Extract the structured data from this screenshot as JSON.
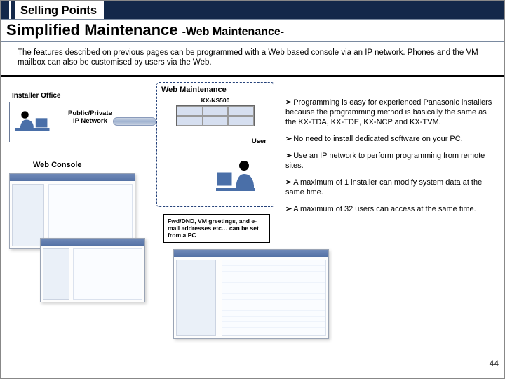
{
  "header": {
    "section": "Selling Points",
    "title_main": "Simplified Maintenance ",
    "title_sub": "-Web Maintenance-"
  },
  "intro": "The features described on previous pages can be programmed with a Web based console via an IP network. Phones and the VM mailbox can also be customised by users via the Web.",
  "diagram": {
    "installer_office": "Installer Office",
    "network": "Public/Private\nIP Network",
    "panel_title": "Web Maintenance",
    "device": "KX-NS500",
    "user": "User",
    "web_console": "Web Console",
    "note": "Fwd/DND, VM greetings, and e-mail addresses etc… can be set from a PC"
  },
  "bullets": [
    "Programming is easy for experienced Panasonic installers because the programming method is basically the same as the KX-TDA, KX-TDE, KX-NCP and KX-TVM.",
    "No need to install dedicated software on your PC.",
    "Use an IP network to perform programming from remote sites.",
    "A maximum of 1 installer can modify system data at the same time.",
    "A maximum of 32 users can access at the same time."
  ],
  "page": "44"
}
